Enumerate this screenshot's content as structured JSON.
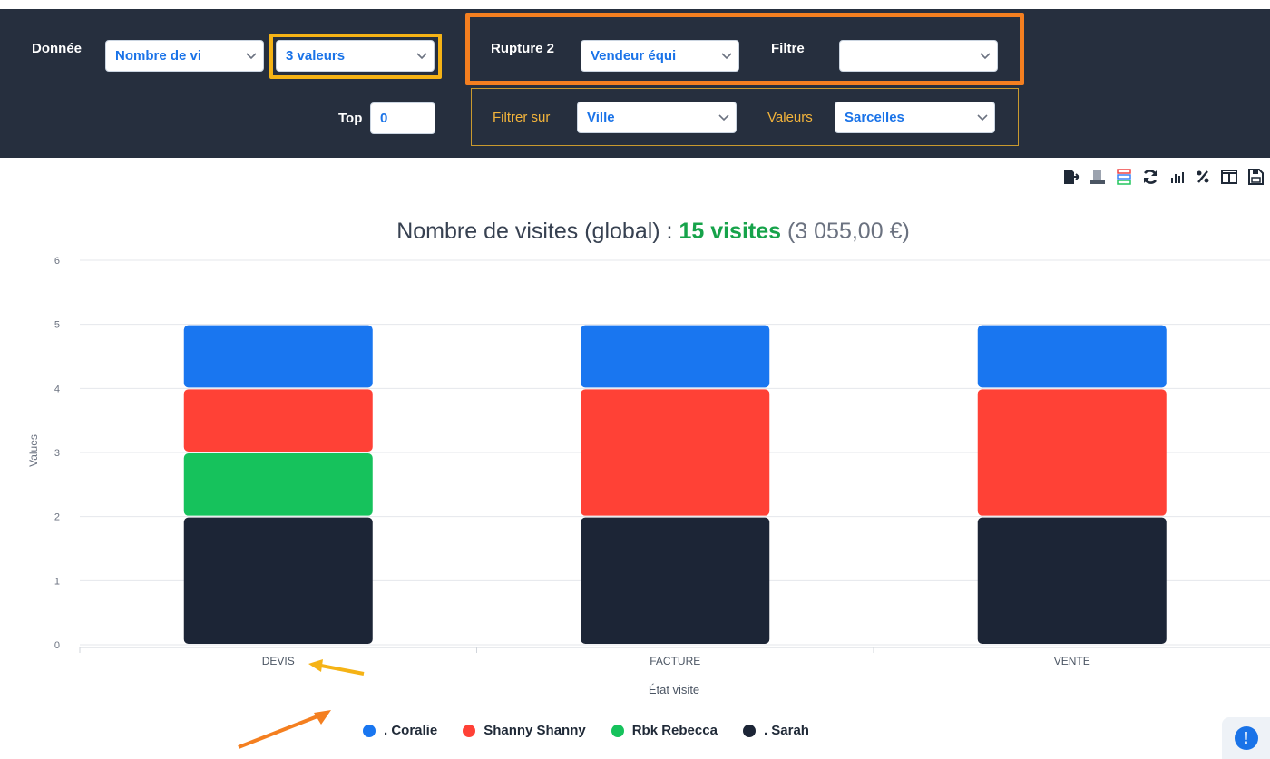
{
  "filters": {
    "donnee_label": "Donnée",
    "donnee_value": "Nombre de vi",
    "valeurs_value": "3 valeurs",
    "top_label": "Top",
    "top_value": "0",
    "rupture_label": "Rupture 2",
    "rupture_value": "Vendeur équi",
    "filtre_label": "Filtre",
    "filtre_value": "",
    "filtrer_sur_label": "Filtrer sur",
    "filtrer_sur_value": "Ville",
    "valeurs_label": "Valeurs",
    "valeurs_filter_value": "Sarcelles"
  },
  "toolbar": {
    "icons": [
      "export-icon",
      "calculator-icon",
      "stacked-rows-icon",
      "refresh-icon",
      "bar-chart-icon",
      "percent-icon",
      "columns-icon",
      "save-icon"
    ]
  },
  "chart_title": {
    "prefix": "Nombre de visites (global) : ",
    "count": "15 visites",
    "amount": " (3 055,00 €)"
  },
  "chart_data": {
    "type": "bar",
    "stacked": true,
    "categories": [
      "DEVIS",
      "FACTURE",
      "VENTE"
    ],
    "series": [
      {
        "name": ". Sarah",
        "values": [
          2,
          2,
          2
        ],
        "color": "#1c2536"
      },
      {
        "name": "Rbk Rebecca",
        "values": [
          1,
          0,
          0
        ],
        "color": "#16c25c"
      },
      {
        "name": "Shanny Shanny",
        "values": [
          1,
          2,
          2
        ],
        "color": "#ff4136"
      },
      {
        "name": ". Coralie",
        "values": [
          1,
          1,
          1
        ],
        "color": "#1976f0"
      }
    ],
    "xlabel": "État visite",
    "ylabel": "Values",
    "ylim": [
      0,
      6
    ],
    "yticks": [
      0,
      1,
      2,
      3,
      4,
      5,
      6
    ]
  },
  "legend": [
    {
      "label": ". Coralie",
      "color": "#1976f0"
    },
    {
      "label": "Shanny Shanny",
      "color": "#ff4136"
    },
    {
      "label": "Rbk Rebecca",
      "color": "#16c25c"
    },
    {
      "label": ". Sarah",
      "color": "#1c2536"
    }
  ],
  "help_button": "!"
}
